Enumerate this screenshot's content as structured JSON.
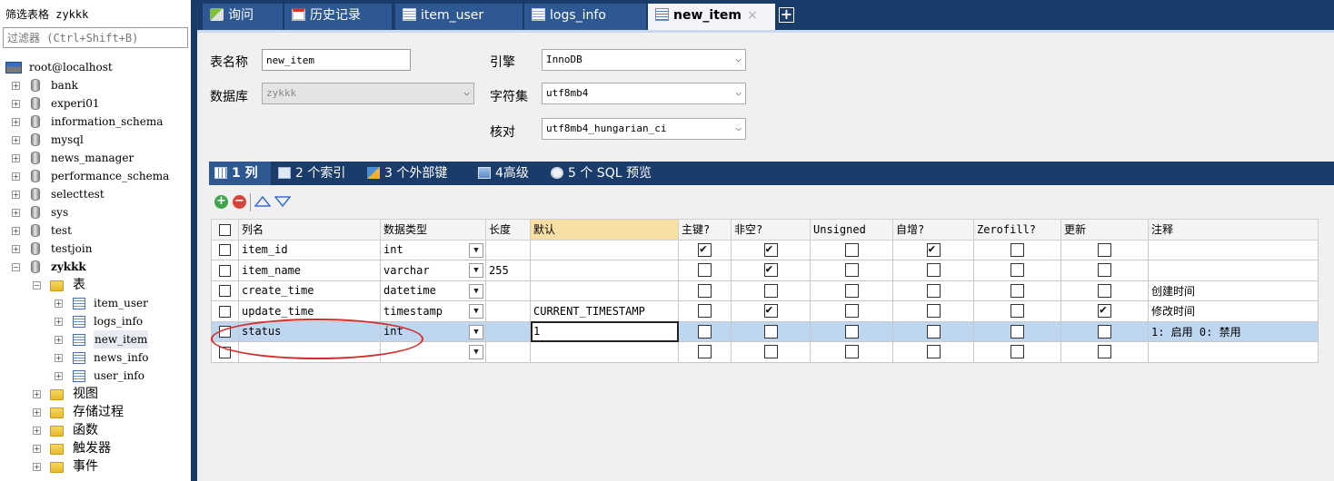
{
  "sidebar": {
    "filter_label": "筛选表格 zykkk",
    "filter_placeholder": "过滤器 (Ctrl+Shift+B)",
    "tree": [
      {
        "label": "root@localhost",
        "kind": "server",
        "level": 0,
        "pm": ""
      },
      {
        "label": "bank",
        "kind": "db",
        "level": 1,
        "pm": "+"
      },
      {
        "label": "experi01",
        "kind": "db",
        "level": 1,
        "pm": "+"
      },
      {
        "label": "information_schema",
        "kind": "db",
        "level": 1,
        "pm": "+"
      },
      {
        "label": "mysql",
        "kind": "db",
        "level": 1,
        "pm": "+"
      },
      {
        "label": "news_manager",
        "kind": "db",
        "level": 1,
        "pm": "+"
      },
      {
        "label": "performance_schema",
        "kind": "db",
        "level": 1,
        "pm": "+"
      },
      {
        "label": "selecttest",
        "kind": "db",
        "level": 1,
        "pm": "+"
      },
      {
        "label": "sys",
        "kind": "db",
        "level": 1,
        "pm": "+"
      },
      {
        "label": "test",
        "kind": "db",
        "level": 1,
        "pm": "+"
      },
      {
        "label": "testjoin",
        "kind": "db",
        "level": 1,
        "pm": "+"
      },
      {
        "label": "zykkk",
        "kind": "db",
        "level": 1,
        "pm": "−",
        "bold": true
      },
      {
        "label": "表",
        "kind": "folder",
        "level": 2,
        "pm": "−"
      },
      {
        "label": "item_user",
        "kind": "table",
        "level": 3,
        "pm": "+"
      },
      {
        "label": "logs_info",
        "kind": "table",
        "level": 3,
        "pm": "+"
      },
      {
        "label": "new_item",
        "kind": "table",
        "level": 3,
        "pm": "+",
        "selected": true
      },
      {
        "label": "news_info",
        "kind": "table",
        "level": 3,
        "pm": "+"
      },
      {
        "label": "user_info",
        "kind": "table",
        "level": 3,
        "pm": "+"
      },
      {
        "label": "视图",
        "kind": "folder",
        "level": 2,
        "pm": "+"
      },
      {
        "label": "存储过程",
        "kind": "folder",
        "level": 2,
        "pm": "+"
      },
      {
        "label": "函数",
        "kind": "folder",
        "level": 2,
        "pm": "+"
      },
      {
        "label": "触发器",
        "kind": "folder",
        "level": 2,
        "pm": "+"
      },
      {
        "label": "事件",
        "kind": "folder",
        "level": 2,
        "pm": "+"
      }
    ]
  },
  "tabs": [
    {
      "label": "询问",
      "icon": "query-icon"
    },
    {
      "label": "历史记录",
      "icon": "history-icon"
    },
    {
      "label": "item_user",
      "icon": "table-icon"
    },
    {
      "label": "logs_info",
      "icon": "table-icon"
    },
    {
      "label": "new_item",
      "icon": "table-edit-icon",
      "active": true,
      "close": "×"
    }
  ],
  "add_tab_label": "+",
  "form": {
    "table_name_label": "表名称",
    "table_name_value": "new_item",
    "database_label": "数据库",
    "database_value": "zykkk",
    "engine_label": "引擎",
    "engine_value": "InnoDB",
    "charset_label": "字符集",
    "charset_value": "utf8mb4",
    "collation_label": "核对",
    "collation_value": "utf8mb4_hungarian_ci"
  },
  "subtabs": [
    {
      "label": "1 列",
      "icon": "columns-icon",
      "active": true
    },
    {
      "label": "2 个索引",
      "icon": "index-icon"
    },
    {
      "label": "3 个外部键",
      "icon": "foreign-key-icon"
    },
    {
      "label": "4高级",
      "icon": "advanced-icon"
    },
    {
      "label": "5 个 SQL 预览",
      "icon": "sql-preview-icon"
    }
  ],
  "grid": {
    "headers": [
      "列名",
      "数据类型",
      "长度",
      "默认",
      "主键?",
      "非空?",
      "Unsigned",
      "自增?",
      "Zerofill?",
      "更新",
      "注释"
    ],
    "rows": [
      {
        "name": "item_id",
        "type": "int",
        "length": "",
        "default": "",
        "pk": true,
        "notnull": true,
        "unsigned": false,
        "ai": true,
        "zerofill": false,
        "update": false,
        "comment": ""
      },
      {
        "name": "item_name",
        "type": "varchar",
        "length": "255",
        "default": "",
        "pk": false,
        "notnull": true,
        "unsigned": false,
        "ai": false,
        "zerofill": false,
        "update": false,
        "comment": ""
      },
      {
        "name": "create_time",
        "type": "datetime",
        "length": "",
        "default": "",
        "pk": false,
        "notnull": false,
        "unsigned": false,
        "ai": false,
        "zerofill": false,
        "update": false,
        "comment": "创建时间"
      },
      {
        "name": "update_time",
        "type": "timestamp",
        "length": "",
        "default": "CURRENT_TIMESTAMP",
        "pk": false,
        "notnull": true,
        "unsigned": false,
        "ai": false,
        "zerofill": false,
        "update": true,
        "comment": "修改时间"
      },
      {
        "name": "status",
        "type": "int",
        "length": "",
        "default": "1",
        "pk": false,
        "notnull": false,
        "unsigned": false,
        "ai": false,
        "zerofill": false,
        "update": false,
        "comment": "1: 启用 0: 禁用",
        "selected": true
      },
      {
        "name": "",
        "type": "",
        "length": "",
        "default": "",
        "pk": false,
        "notnull": false,
        "unsigned": false,
        "ai": false,
        "zerofill": false,
        "update": false,
        "comment": ""
      }
    ]
  },
  "colors": {
    "header_bar": "#1a3c6b",
    "tab_inactive": "#2e5891",
    "selected_row": "#bed6f0",
    "highlight_header": "#f7dfa6",
    "annotation": "#d0302e"
  }
}
